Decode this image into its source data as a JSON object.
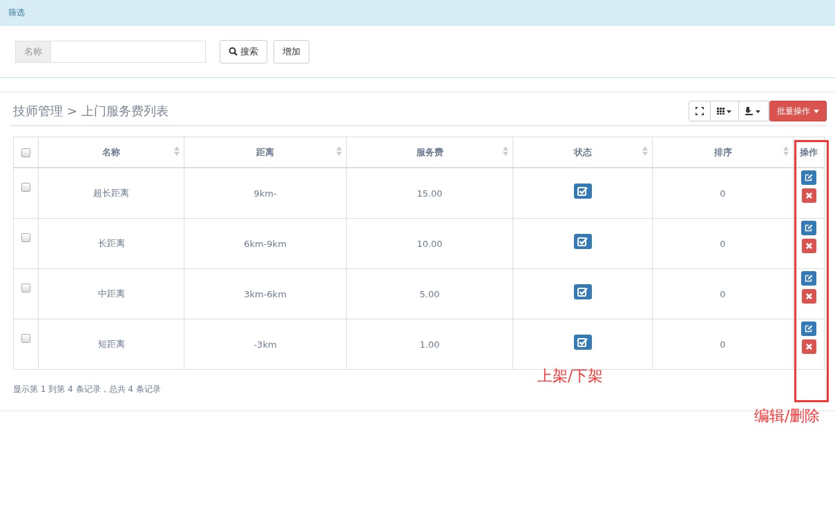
{
  "panel": {
    "title": "筛选"
  },
  "filter": {
    "label": "名称",
    "buttons": [
      {
        "kind": "search",
        "label": "搜索"
      },
      {
        "kind": "plain",
        "label": "增加"
      }
    ]
  },
  "breadcrumb": "技师管理 > 上门服务费列表",
  "toolbar": {
    "batch_label": "批量操作"
  },
  "table": {
    "header_checked": false,
    "columns": [
      {
        "label": "名称",
        "sortable": true
      },
      {
        "label": "距离",
        "sortable": true
      },
      {
        "label": "服务费",
        "sortable": true
      },
      {
        "label": "状态",
        "sortable": true
      },
      {
        "label": "排序",
        "sortable": true
      },
      {
        "label": "操作",
        "sortable": false
      }
    ],
    "rows": [
      {
        "checked": false,
        "name": "超长距离",
        "distance": "9km-",
        "fee": "15.00",
        "on": true,
        "order": "0"
      },
      {
        "checked": false,
        "name": "长距离",
        "distance": "6km-9km",
        "fee": "10.00",
        "on": true,
        "order": "0"
      },
      {
        "checked": false,
        "name": "中距离",
        "distance": "3km-6km",
        "fee": "5.00",
        "on": true,
        "order": "0"
      },
      {
        "checked": false,
        "name": "短距离",
        "distance": "-3km",
        "fee": "1.00",
        "on": true,
        "order": "0"
      }
    ]
  },
  "pagination_info": "显示第 1 到第 4 条记录，总共 4 条记录",
  "annotations": [
    {
      "kind": "label",
      "text": "上架/下架"
    },
    {
      "kind": "label",
      "text": "编辑/删除"
    }
  ]
}
